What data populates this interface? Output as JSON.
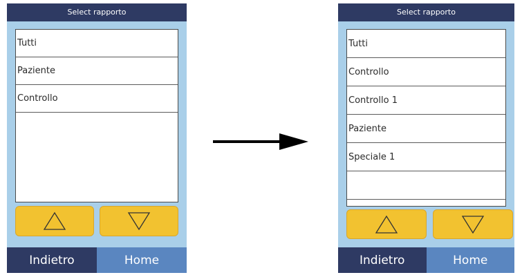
{
  "colors": {
    "device_background": "#a9cfe9",
    "title_bar": "#2e3a63",
    "back_button": "#2e3a63",
    "home_button": "#5a86c0",
    "scroll_buttons": "#f2c230"
  },
  "before": {
    "title": "Select rapporto",
    "items": [
      {
        "label": "Tutti"
      },
      {
        "label": "Paziente"
      },
      {
        "label": "Controllo"
      }
    ],
    "scroll_up_icon": "triangle-up-outline",
    "scroll_down_icon": "triangle-down-outline",
    "back_label": "Indietro",
    "home_label": "Home"
  },
  "after": {
    "title": "Select rapporto",
    "items": [
      {
        "label": "Tutti"
      },
      {
        "label": "Controllo"
      },
      {
        "label": "Controllo 1"
      },
      {
        "label": "Paziente"
      },
      {
        "label": "Speciale 1"
      }
    ],
    "scroll_up_icon": "triangle-up-outline",
    "scroll_down_icon": "triangle-down-outline",
    "back_label": "Indietro",
    "home_label": "Home"
  },
  "transition_icon": "right-arrow"
}
